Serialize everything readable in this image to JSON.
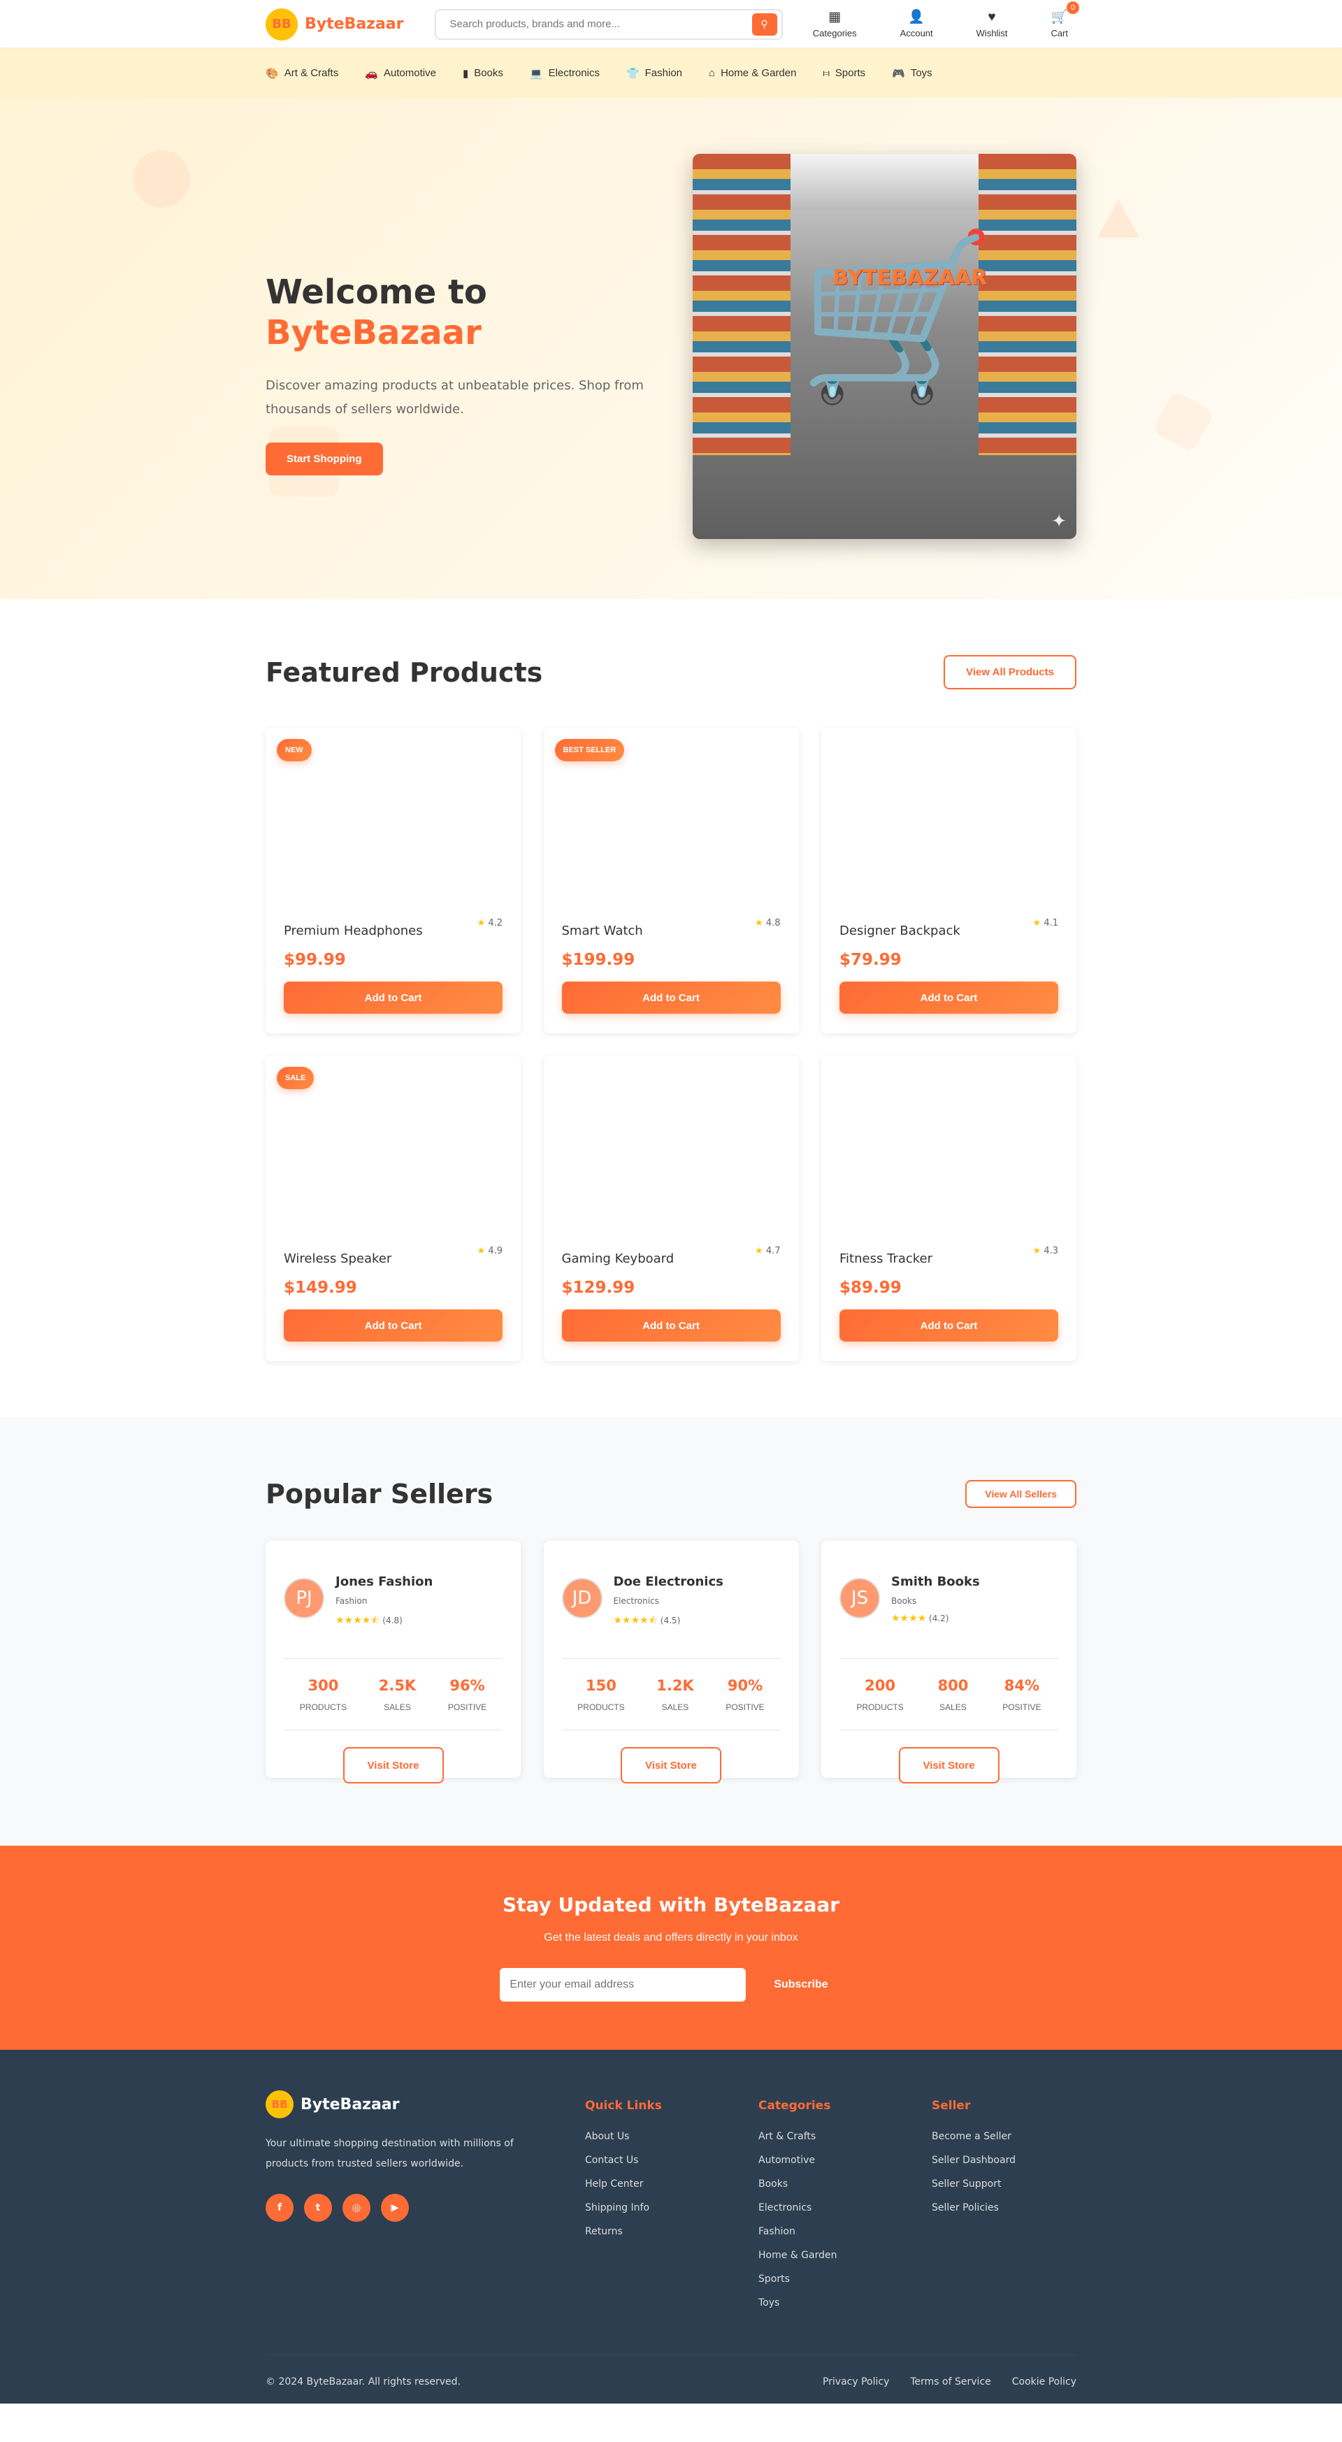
{
  "brand": {
    "name": "ByteBazaar",
    "logo_text": "BB",
    "accent": "#ff6b35",
    "logo_bg": "#ffc107"
  },
  "header": {
    "search_placeholder": "Search products, brands and more...",
    "icons": [
      {
        "label": "Categories",
        "icon": "grid-icon"
      },
      {
        "label": "Account",
        "icon": "user-icon"
      },
      {
        "label": "Wishlist",
        "icon": "heart-icon"
      },
      {
        "label": "Cart",
        "icon": "cart-icon"
      }
    ],
    "cart_count": "0"
  },
  "catnav": [
    {
      "label": "Art & Crafts",
      "icon": "palette-icon"
    },
    {
      "label": "Automotive",
      "icon": "car-icon"
    },
    {
      "label": "Books",
      "icon": "book-icon"
    },
    {
      "label": "Electronics",
      "icon": "laptop-icon"
    },
    {
      "label": "Fashion",
      "icon": "shirt-icon"
    },
    {
      "label": "Home & Garden",
      "icon": "home-icon"
    },
    {
      "label": "Sports",
      "icon": "dumbbell-icon"
    },
    {
      "label": "Toys",
      "icon": "gamepad-icon"
    }
  ],
  "hero": {
    "title_prefix": "Welcome to",
    "title_brand": "ByteBazaar",
    "subtitle": "Discover amazing products at unbeatable prices. Shop from thousands of sellers worldwide.",
    "cta": "Start Shopping",
    "image_brand": "BYTEBAZAAR"
  },
  "featured": {
    "title": "Featured Products",
    "view_all": "View All Products",
    "add_label": "Add to Cart",
    "products": [
      {
        "name": "Premium Headphones",
        "rating": "4.2",
        "price": "$99.99",
        "badge": "NEW"
      },
      {
        "name": "Smart Watch",
        "rating": "4.8",
        "price": "$199.99",
        "badge": "BEST SELLER"
      },
      {
        "name": "Designer Backpack",
        "rating": "4.1",
        "price": "$79.99",
        "badge": ""
      },
      {
        "name": "Wireless Speaker",
        "rating": "4.9",
        "price": "$149.99",
        "badge": "SALE"
      },
      {
        "name": "Gaming Keyboard",
        "rating": "4.7",
        "price": "$129.99",
        "badge": ""
      },
      {
        "name": "Fitness Tracker",
        "rating": "4.3",
        "price": "$89.99",
        "badge": ""
      }
    ]
  },
  "sellers": {
    "title": "Popular Sellers",
    "view_all": "View All Sellers",
    "visit_label": "Visit Store",
    "stat_labels": [
      "PRODUCTS",
      "SALES",
      "POSITIVE"
    ],
    "items": [
      {
        "initials": "PJ",
        "name": "Jones Fashion",
        "category": "Fashion",
        "stars": "★★★★⯪",
        "rating": "(4.8)",
        "products": "300",
        "sales": "2.5K",
        "positive": "96%"
      },
      {
        "initials": "JD",
        "name": "Doe Electronics",
        "category": "Electronics",
        "stars": "★★★★⯪",
        "rating": "(4.5)",
        "products": "150",
        "sales": "1.2K",
        "positive": "90%"
      },
      {
        "initials": "JS",
        "name": "Smith Books",
        "category": "Books",
        "stars": "★★★★",
        "rating": "(4.2)",
        "products": "200",
        "sales": "800",
        "positive": "84%"
      }
    ]
  },
  "newsletter": {
    "title": "Stay Updated with ByteBazaar",
    "subtitle": "Get the latest deals and offers directly in your inbox",
    "placeholder": "Enter your email address",
    "button": "Subscribe"
  },
  "footer": {
    "description": "Your ultimate shopping destination with millions of products from trusted sellers worldwide.",
    "social": [
      "facebook-icon",
      "twitter-icon",
      "instagram-icon",
      "youtube-icon"
    ],
    "columns": [
      {
        "title": "Quick Links",
        "links": [
          "About Us",
          "Contact Us",
          "Help Center",
          "Shipping Info",
          "Returns"
        ]
      },
      {
        "title": "Categories",
        "links": [
          "Art & Crafts",
          "Automotive",
          "Books",
          "Electronics",
          "Fashion",
          "Home & Garden",
          "Sports",
          "Toys"
        ]
      },
      {
        "title": "Seller",
        "links": [
          "Become a Seller",
          "Seller Dashboard",
          "Seller Support",
          "Seller Policies"
        ]
      }
    ],
    "copyright": "© 2024 ByteBazaar. All rights reserved.",
    "legal": [
      "Privacy Policy",
      "Terms of Service",
      "Cookie Policy"
    ]
  }
}
